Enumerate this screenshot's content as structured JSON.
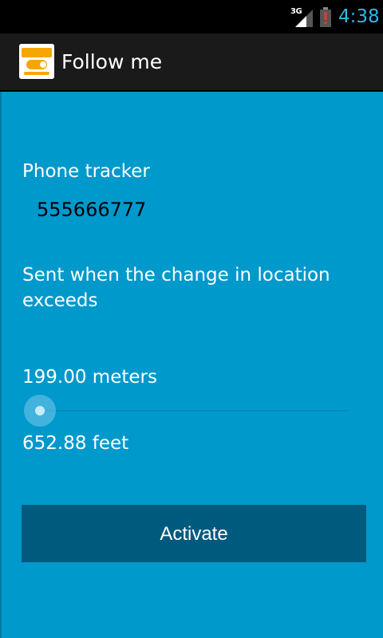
{
  "status_bar": {
    "network": "3G",
    "time": "4:38",
    "icons": [
      "signal-icon",
      "battery-alert-icon"
    ],
    "clock_color": "#33b5e5"
  },
  "action_bar": {
    "icon": "follow-me-logo-icon",
    "title": "Follow me"
  },
  "content": {
    "phone_label": "Phone tracker",
    "phone_value": "555666777",
    "description": "Sent when the change in location exceeds",
    "meters_text": "199.00 meters",
    "feet_text": "652.88 feet",
    "slider_value_fraction": 0.0,
    "activate_label": "Activate"
  },
  "colors": {
    "background": "#0099cc",
    "button": "#005a7d",
    "action_bar": "#1a1a1a"
  }
}
